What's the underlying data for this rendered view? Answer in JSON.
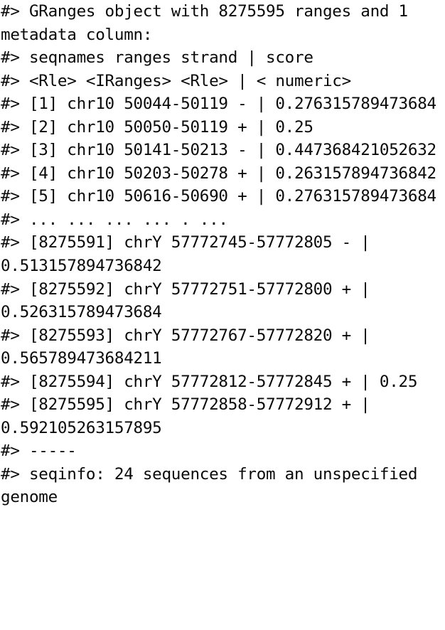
{
  "console": {
    "prompt_prefix": "#>",
    "background_color": "#ffffff",
    "text_color": "#0a0a0a",
    "object_type": "GRanges",
    "lines": [
      "#> GRanges object with 8275595 ranges and 1 metadata column:",
      "#> seqnames ranges strand | score",
      "#> <Rle> <IRanges> <Rle> | < numeric>",
      "#> [1] chr10 50044-50119 - | 0.276315789473684",
      "#> [2] chr10 50050-50119 + | 0.25",
      "#> [3] chr10 50141-50213 - | 0.447368421052632",
      "#> [4] chr10 50203-50278 + | 0.263157894736842",
      "#> [5] chr10 50616-50690 + | 0.276315789473684",
      "#> ... ... ... ... . ...",
      "#> [8275591] chrY 57772745-57772805 - | 0.513157894736842",
      "#> [8275592] chrY 57772751-57772800 + | 0.526315789473684",
      "#> [8275593] chrY 57772767-57772820 + | 0.565789473684211",
      "#> [8275594] chrY 57772812-57772845 + | 0.25",
      "#> [8275595] chrY 57772858-57772912 + | 0.592105263157895",
      "#> -----",
      "#> seqinfo: 24 sequences from an unspecified genome"
    ],
    "summary": {
      "range_count": "8275595",
      "metadata_column_count": "1",
      "seqinfo_sequence_count": "24",
      "seqinfo_genome": "unspecified genome",
      "separator": "-----"
    },
    "columns": {
      "headers": [
        "seqnames",
        "ranges",
        "strand",
        "score"
      ],
      "types": [
        "<Rle>",
        "<IRanges>",
        "<Rle>",
        "< numeric>"
      ]
    },
    "rows": [
      {
        "index": "[1]",
        "seqnames": "chr10",
        "ranges": "50044-50119",
        "strand": "-",
        "score": "0.276315789473684"
      },
      {
        "index": "[2]",
        "seqnames": "chr10",
        "ranges": "50050-50119",
        "strand": "+",
        "score": "0.25"
      },
      {
        "index": "[3]",
        "seqnames": "chr10",
        "ranges": "50141-50213",
        "strand": "-",
        "score": "0.447368421052632"
      },
      {
        "index": "[4]",
        "seqnames": "chr10",
        "ranges": "50203-50278",
        "strand": "+",
        "score": "0.263157894736842"
      },
      {
        "index": "[5]",
        "seqnames": "chr10",
        "ranges": "50616-50690",
        "strand": "+",
        "score": "0.276315789473684"
      },
      {
        "index": "...",
        "seqnames": "...",
        "ranges": "...",
        "strand": ".",
        "score": "..."
      },
      {
        "index": "[8275591]",
        "seqnames": "chrY",
        "ranges": "57772745-57772805",
        "strand": "-",
        "score": "0.513157894736842"
      },
      {
        "index": "[8275592]",
        "seqnames": "chrY",
        "ranges": "57772751-57772800",
        "strand": "+",
        "score": "0.526315789473684"
      },
      {
        "index": "[8275593]",
        "seqnames": "chrY",
        "ranges": "57772767-57772820",
        "strand": "+",
        "score": "0.565789473684211"
      },
      {
        "index": "[8275594]",
        "seqnames": "chrY",
        "ranges": "57772812-57772845",
        "strand": "+",
        "score": "0.25"
      },
      {
        "index": "[8275595]",
        "seqnames": "chrY",
        "ranges": "57772858-57772912",
        "strand": "+",
        "score": "0.592105263157895"
      }
    ]
  }
}
